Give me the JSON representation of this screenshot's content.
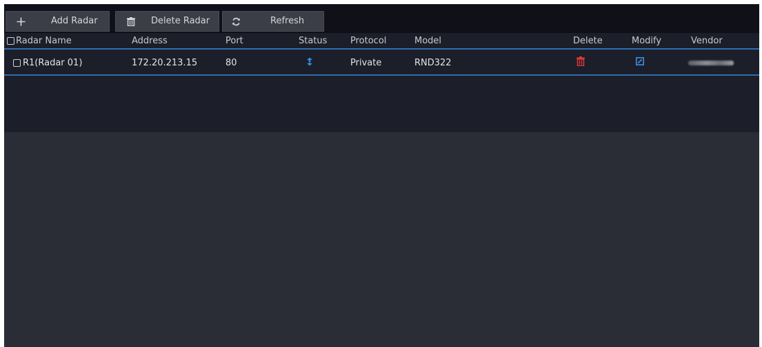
{
  "toolbar": {
    "add_label": "Add Radar",
    "delete_label": "Delete Radar",
    "refresh_label": "Refresh"
  },
  "table": {
    "columns": [
      "Radar Name",
      "Address",
      "Port",
      "Status",
      "Protocol",
      "Model",
      "Delete",
      "Modify",
      "Vendor"
    ],
    "rows": [
      {
        "name": "R1(Radar 01)",
        "address": "172.20.213.15",
        "port": "80",
        "status_icon": "online-icon",
        "protocol": "Private",
        "model": "RND322",
        "delete_icon": "trash-icon",
        "modify_icon": "edit-icon"
      }
    ]
  },
  "colors": {
    "accent": "#2f6fb0",
    "status_blue": "#2e8fe0",
    "delete_red": "#e03a3a",
    "modify_blue": "#3a8fe6"
  }
}
